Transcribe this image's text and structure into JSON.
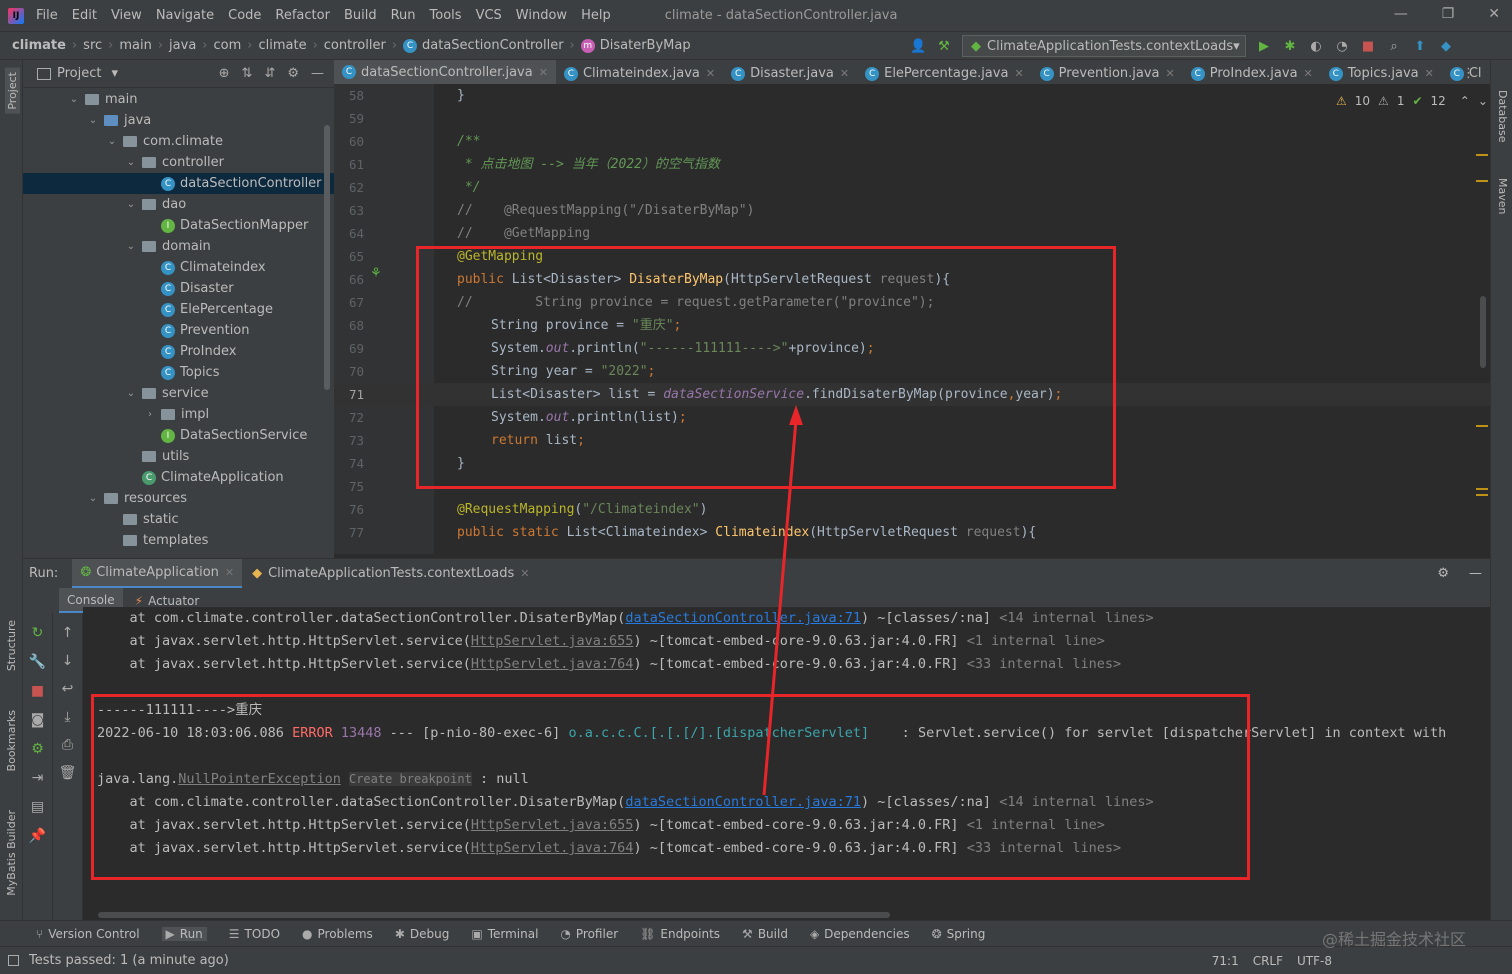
{
  "menu": {
    "items": [
      "File",
      "Edit",
      "View",
      "Navigate",
      "Code",
      "Refactor",
      "Build",
      "Run",
      "Tools",
      "VCS",
      "Window",
      "Help"
    ],
    "window_title": "climate - dataSectionController.java"
  },
  "breadcrumb": [
    "climate",
    "src",
    "main",
    "java",
    "com",
    "climate",
    "controller",
    "dataSectionController",
    "DisaterByMap"
  ],
  "run_config": "ClimateApplicationTests.contextLoads",
  "project_panel": {
    "title": "Project",
    "tree": [
      {
        "label": "main",
        "depth": 0,
        "kind": "folder",
        "open": true
      },
      {
        "label": "java",
        "depth": 1,
        "kind": "folder-blue",
        "open": true
      },
      {
        "label": "com.climate",
        "depth": 2,
        "kind": "package",
        "open": true
      },
      {
        "label": "controller",
        "depth": 3,
        "kind": "package",
        "open": true
      },
      {
        "label": "dataSectionController",
        "depth": 4,
        "kind": "class",
        "selected": true
      },
      {
        "label": "dao",
        "depth": 3,
        "kind": "package",
        "open": true
      },
      {
        "label": "DataSectionMapper",
        "depth": 4,
        "kind": "interface"
      },
      {
        "label": "domain",
        "depth": 3,
        "kind": "package",
        "open": true
      },
      {
        "label": "Climateindex",
        "depth": 4,
        "kind": "class"
      },
      {
        "label": "Disaster",
        "depth": 4,
        "kind": "class"
      },
      {
        "label": "ElePercentage",
        "depth": 4,
        "kind": "class"
      },
      {
        "label": "Prevention",
        "depth": 4,
        "kind": "class"
      },
      {
        "label": "ProIndex",
        "depth": 4,
        "kind": "class"
      },
      {
        "label": "Topics",
        "depth": 4,
        "kind": "class"
      },
      {
        "label": "service",
        "depth": 3,
        "kind": "package",
        "open": true
      },
      {
        "label": "impl",
        "depth": 4,
        "kind": "package",
        "closed": true
      },
      {
        "label": "DataSectionService",
        "depth": 4,
        "kind": "interface"
      },
      {
        "label": "utils",
        "depth": 3,
        "kind": "package"
      },
      {
        "label": "ClimateApplication",
        "depth": 3,
        "kind": "app"
      },
      {
        "label": "resources",
        "depth": 1,
        "kind": "folder",
        "open": true
      },
      {
        "label": "static",
        "depth": 2,
        "kind": "folder"
      },
      {
        "label": "templates",
        "depth": 2,
        "kind": "folder"
      }
    ]
  },
  "editor_tabs": [
    "dataSectionController.java",
    "Climateindex.java",
    "Disaster.java",
    "ElePercentage.java",
    "Prevention.java",
    "ProIndex.java",
    "Topics.java",
    "Cl"
  ],
  "inspections": {
    "warnings": "10",
    "weak": "1",
    "ok": "12"
  },
  "code_lines": [
    {
      "n": "58",
      "html": "<span>}</span>",
      "indent": 0
    },
    {
      "n": "59",
      "html": "",
      "indent": 0
    },
    {
      "n": "60",
      "html": "<span class='cmt'>/**</span>",
      "indent": 0
    },
    {
      "n": "61",
      "html": "<span class='cmt'> * 点击地图 --&gt; 当年（2022）的空气指数</span>",
      "indent": 0
    },
    {
      "n": "62",
      "html": "<span class='cmt'> */</span>",
      "indent": 0
    },
    {
      "n": "63",
      "html": "<span class='lc'>//    @RequestMapping(\"/DisaterByMap\")</span>",
      "indent": -1
    },
    {
      "n": "64",
      "html": "<span class='lc'>//    @GetMapping</span>",
      "indent": -1
    },
    {
      "n": "65",
      "html": "<span class='ann'>@GetMapping</span>",
      "indent": 0
    },
    {
      "n": "66",
      "html": "<span class='kw'>public </span>List&lt;Disaster&gt; <span class='mth'>DisaterByMap</span>(HttpServletRequest <span class='prm'>request</span>){",
      "indent": 0
    },
    {
      "n": "67",
      "html": "<span class='lc'>//        String province = request.getParameter(\"province\");</span>",
      "indent": -1
    },
    {
      "n": "68",
      "html": "String province = <span class='str'>\"重庆\"</span><span class='kw'>;</span>",
      "indent": 1
    },
    {
      "n": "69",
      "html": "System.<span class='fld'>out</span>.println(<span class='str'>\"------111111----&gt;\"</span>+province)<span class='kw'>;</span>",
      "indent": 1
    },
    {
      "n": "70",
      "html": "String year = <span class='str'>\"2022\"</span><span class='kw'>;</span>",
      "indent": 1
    },
    {
      "n": "71",
      "html": "List&lt;Disaster&gt; list = <span class='fld'>dataSectionService</span>.findDisaterByMap(province<span class='kw'>,</span>year)<span class='kw'>;</span>",
      "indent": 1,
      "current": true
    },
    {
      "n": "72",
      "html": "System.<span class='fld'>out</span>.println(list)<span class='kw'>;</span>",
      "indent": 1
    },
    {
      "n": "73",
      "html": "<span class='kw'>return </span>list<span class='kw'>;</span>",
      "indent": 1
    },
    {
      "n": "74",
      "html": "}",
      "indent": 0
    },
    {
      "n": "75",
      "html": "",
      "indent": 0
    },
    {
      "n": "76",
      "html": "<span class='ann'>@RequestMapping</span>(<span class='str'>\"/Climateindex\"</span>)",
      "indent": 0
    },
    {
      "n": "77",
      "html": "<span class='kw'>public static </span>List&lt;Climateindex&gt; <span class='mth'>Climateindex</span>(HttpServletRequest <span class='prm'>request</span>){",
      "indent": 0
    }
  ],
  "run_panel": {
    "label": "Run:",
    "tabs": [
      "ClimateApplication",
      "ClimateApplicationTests.contextLoads"
    ],
    "subtabs": [
      "Console",
      "Actuator"
    ]
  },
  "console_lines": [
    "    at com.climate.controller.dataSectionController.DisaterByMap(<span class='lnk'>dataSectionController.java:71</span>) ~[classes/:na] <span class='gray'>&lt;14 internal lines&gt;</span>",
    "    at javax.servlet.http.HttpServlet.service(<span class='glnk'>HttpServlet.java:655</span>) ~[tomcat-embed-core-9.0.63.jar:4.0.FR] <span class='gray'>&lt;1 internal line&gt;</span>",
    "    at javax.servlet.http.HttpServlet.service(<span class='glnk'>HttpServlet.java:764</span>) ~[tomcat-embed-core-9.0.63.jar:4.0.FR] <span class='gray'>&lt;33 internal lines&gt;</span>",
    "",
    "------111111----&gt;重庆",
    "2022-06-10 18:03:06.086 <span class='err'>ERROR</span> <span class='pid'>13448</span> --- [p-nio-80-exec-6] <span class='cyan'>o.a.c.c.C.[.[.[/].[dispatcherServlet]</span>    : Servlet.service() for servlet [dispatcherServlet] in context with",
    "",
    "java.lang.<span class='glnk'>NullPointerException</span> <span class='hint'>Create breakpoint</span> : null",
    "    at com.climate.controller.dataSectionController.DisaterByMap(<span class='lnk'>dataSectionController.java:71</span>) ~[classes/:na] <span class='gray'>&lt;14 internal lines&gt;</span>",
    "    at javax.servlet.http.HttpServlet.service(<span class='glnk'>HttpServlet.java:655</span>) ~[tomcat-embed-core-9.0.63.jar:4.0.FR] <span class='gray'>&lt;1 internal line&gt;</span>",
    "    at javax.servlet.http.HttpServlet.service(<span class='glnk'>HttpServlet.java:764</span>) ~[tomcat-embed-core-9.0.63.jar:4.0.FR] <span class='gray'>&lt;33 internal lines&gt;</span>"
  ],
  "tool_windows": [
    "Version Control",
    "Run",
    "TODO",
    "Problems",
    "Debug",
    "Terminal",
    "Profiler",
    "Endpoints",
    "Build",
    "Dependencies",
    "Spring"
  ],
  "status": {
    "message": "Tests passed: 1 (a minute ago)",
    "position": "71:1",
    "line_sep": "CRLF",
    "encoding": "UTF-8",
    "watermark": "@稀土掘金技术社区"
  },
  "side_labels": {
    "left": [
      "Project",
      "Structure",
      "Bookmarks",
      "MyBatis Builder"
    ],
    "right": [
      "Database",
      "Maven"
    ]
  },
  "colors": {
    "annotation_box": "#e8262a",
    "accent": "#4a88c7"
  }
}
